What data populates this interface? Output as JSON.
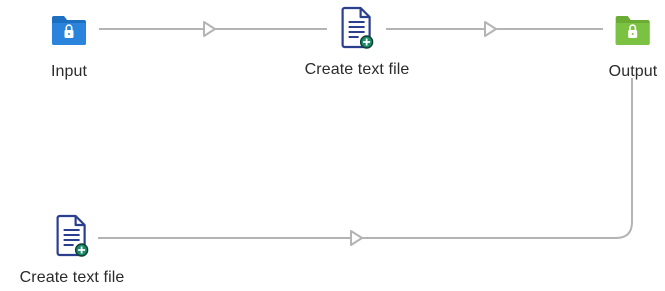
{
  "workflow": {
    "nodes": [
      {
        "id": "input",
        "label": "Input",
        "kind": "folder",
        "icon": "locked-folder-icon",
        "color": "#1d6fc1"
      },
      {
        "id": "create1",
        "label": "Create text file",
        "kind": "task",
        "icon": "create-text-file-icon",
        "color": "#2b3f8f"
      },
      {
        "id": "output",
        "label": "Output",
        "kind": "folder",
        "icon": "locked-folder-icon",
        "color": "#7cc242"
      },
      {
        "id": "create2",
        "label": "Create text file",
        "kind": "task",
        "icon": "create-text-file-icon",
        "color": "#2b3f8f"
      }
    ],
    "connections": [
      {
        "from": "input",
        "to": "create1"
      },
      {
        "from": "create1",
        "to": "output"
      },
      {
        "from": "output",
        "to": "create2"
      }
    ],
    "connector_color": "#b4b4b4",
    "badge_color": "#1a8a6a"
  }
}
